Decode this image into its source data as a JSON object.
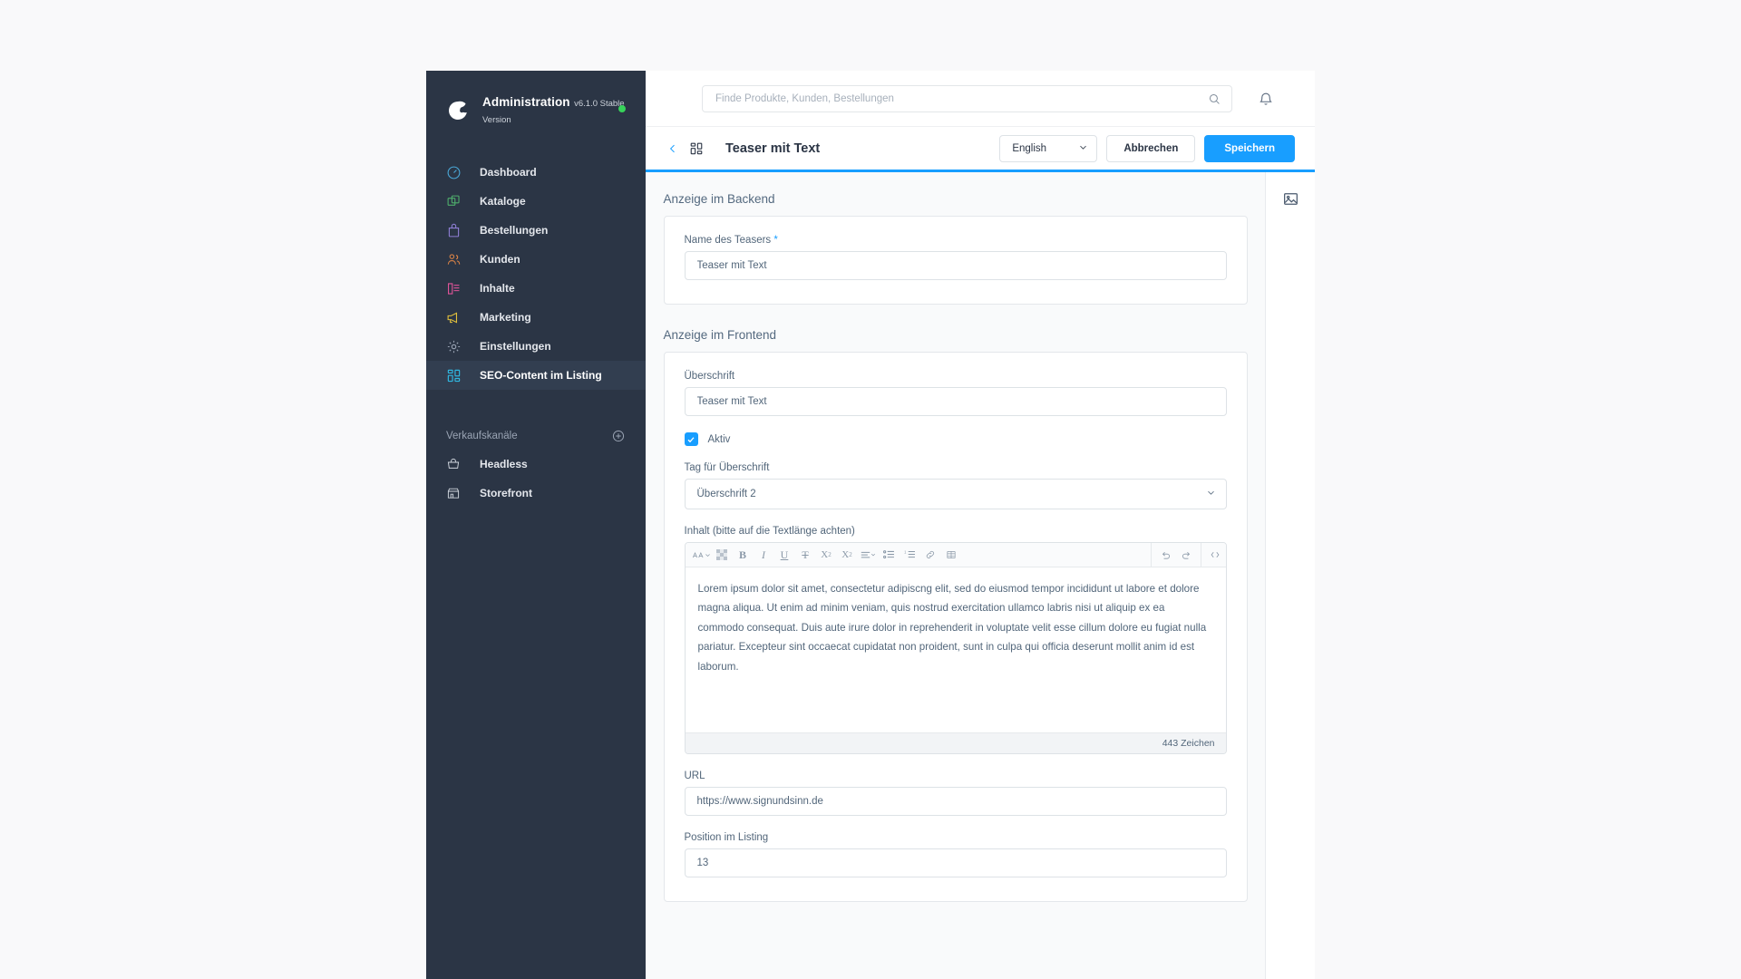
{
  "sidebar": {
    "brand": {
      "title": "Administration",
      "version": "v6.1.0 Stable Version",
      "status_color": "#37d35a"
    },
    "items": [
      {
        "label": "Dashboard",
        "icon": "gauge-icon",
        "color": "#4aa8d8"
      },
      {
        "label": "Kataloge",
        "icon": "copy-icon",
        "color": "#4fae6c"
      },
      {
        "label": "Bestellungen",
        "icon": "bag-icon",
        "color": "#8e7ed4"
      },
      {
        "label": "Kunden",
        "icon": "users-icon",
        "color": "#d98246"
      },
      {
        "label": "Inhalte",
        "icon": "content-icon",
        "color": "#e0549a"
      },
      {
        "label": "Marketing",
        "icon": "megaphone-icon",
        "color": "#e3c13c"
      },
      {
        "label": "Einstellungen",
        "icon": "gear-icon",
        "color": "#9aa4b4"
      },
      {
        "label": "SEO-Content im Listing",
        "icon": "grid-icon",
        "color": "#2fb6e0",
        "active": true
      }
    ],
    "channels_title": "Verkaufskanäle",
    "channels": [
      {
        "label": "Headless",
        "icon": "basket-icon"
      },
      {
        "label": "Storefront",
        "icon": "store-icon"
      }
    ]
  },
  "topbar": {
    "search_placeholder": "Finde Produkte, Kunden, Bestellungen",
    "search_value": "",
    "search_icon": "search-icon",
    "notification_icon": "bell-icon"
  },
  "pagehead": {
    "back_icon": "chevron-left-icon",
    "module_icon": "grid-icon",
    "title": "Teaser mit Text",
    "language": "English",
    "cancel_label": "Abbrechen",
    "save_label": "Speichern",
    "accent_color": "#189eff"
  },
  "sections": {
    "backend": {
      "title": "Anzeige im Backend",
      "name_label": "Name des Teasers",
      "name_required": "*",
      "name_value": "Teaser mit Text"
    },
    "frontend": {
      "title": "Anzeige im Frontend",
      "heading_label": "Überschrift",
      "heading_value": "Teaser mit Text",
      "active_label": "Aktiv",
      "active_checked": true,
      "tag_label": "Tag für Überschrift",
      "tag_value": "Überschrift 2",
      "content_label": "Inhalt (bitte auf die Textlänge achten)",
      "content_value": "Lorem ipsum dolor sit amet, consectetur adipiscng elit, sed do eiusmod tempor incididunt ut labore et dolore magna aliqua. Ut enim ad minim veniam, quis nostrud exercitation ullamco labris nisi ut aliquip ex ea commodo consequat. Duis aute irure dolor in reprehenderit in voluptate velit esse cillum dolore eu fugiat nulla pariatur. Excepteur sint occaecat cupidatat non proident, sunt in culpa qui officia deserunt mollit anim id est laborum.",
      "char_count": "443 Zeichen",
      "url_label": "URL",
      "url_value": "https://www.signundsinn.de",
      "position_label": "Position im Listing",
      "position_value": "13"
    }
  },
  "editor_toolbar": {
    "buttons": [
      {
        "name": "font-format-icon",
        "glyph": "A"
      },
      {
        "name": "color-swatch-icon",
        "glyph": ""
      },
      {
        "name": "bold-icon",
        "glyph": "B"
      },
      {
        "name": "italic-icon",
        "glyph": "I"
      },
      {
        "name": "underline-icon",
        "glyph": "U"
      },
      {
        "name": "strikethrough-icon",
        "glyph": "S"
      },
      {
        "name": "superscript-icon",
        "glyph": "X"
      },
      {
        "name": "subscript-icon",
        "glyph": "X"
      },
      {
        "name": "align-icon",
        "glyph": ""
      },
      {
        "name": "bullet-list-icon",
        "glyph": ""
      },
      {
        "name": "ordered-list-icon",
        "glyph": ""
      },
      {
        "name": "link-icon",
        "glyph": ""
      },
      {
        "name": "table-icon",
        "glyph": ""
      }
    ],
    "right_buttons": [
      {
        "name": "undo-icon"
      },
      {
        "name": "redo-icon"
      },
      {
        "name": "code-view-icon"
      }
    ]
  },
  "rightpanel": {
    "icon": "image-icon"
  }
}
